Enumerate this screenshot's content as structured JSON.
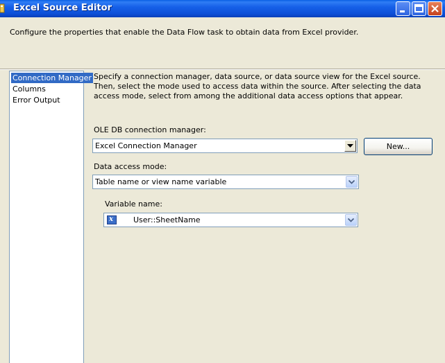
{
  "window": {
    "title": "Excel Source Editor"
  },
  "header": {
    "description": "Configure the properties that enable the Data Flow task to obtain data from Excel provider."
  },
  "nav": {
    "items": [
      {
        "label": "Connection Manager",
        "selected": true
      },
      {
        "label": "Columns",
        "selected": false
      },
      {
        "label": "Error Output",
        "selected": false
      }
    ]
  },
  "main": {
    "description": "Specify a connection manager, data source, or data source view for the Excel source. Then, select the mode used to access data within the source. After selecting the data access mode, select from among the additional data access options that appear.",
    "connection_label": "OLE DB connection manager:",
    "connection_value": "Excel Connection Manager",
    "new_button": "New...",
    "access_mode_label": "Data access mode:",
    "access_mode_value": "Table name or view name variable",
    "variable_label": "Variable name:",
    "variable_value": "User::SheetName",
    "variable_icon": "x-variable-icon"
  },
  "colors": {
    "titlebar": "#0D4FD7",
    "selection": "#316AC5",
    "background": "#ECE9D8"
  }
}
